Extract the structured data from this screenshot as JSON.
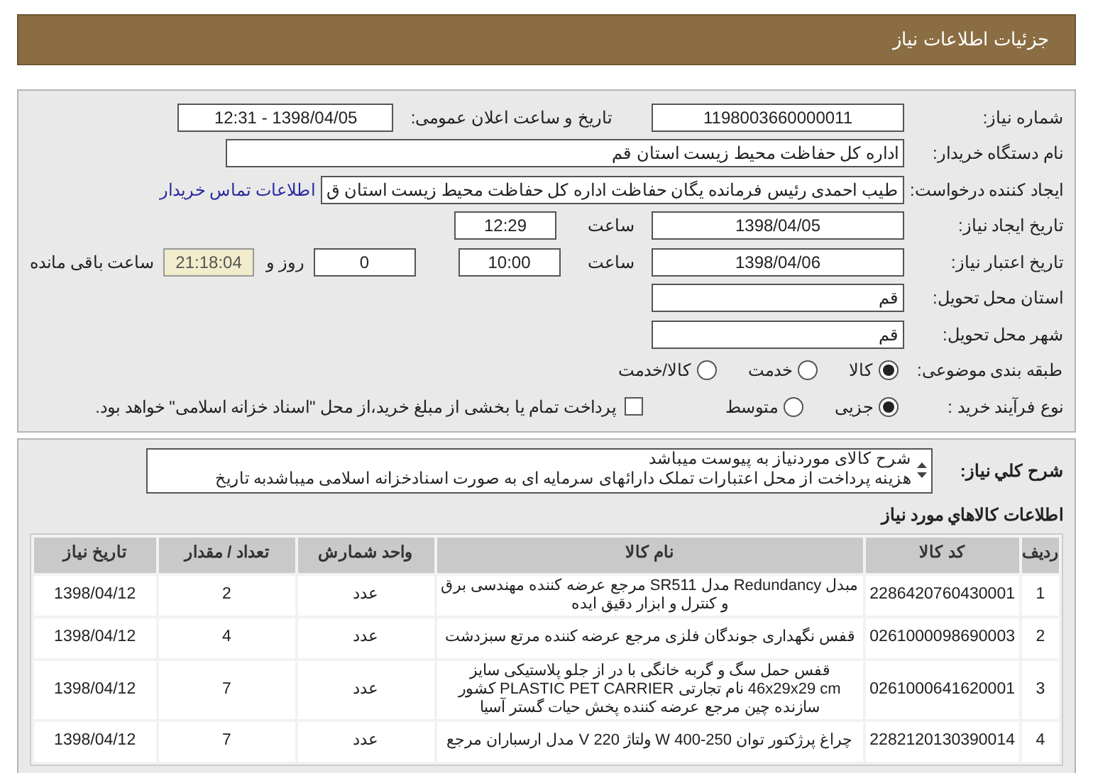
{
  "header": {
    "title": "جزئیات اطلاعات نیاز"
  },
  "fields": {
    "need_number": {
      "label": "شماره نیاز:",
      "value": "1198003660000011"
    },
    "announce": {
      "label": "تاریخ و ساعت اعلان عمومی:",
      "value": "1398/04/05 - 12:31"
    },
    "buyer": {
      "label": "نام دستگاه خریدار:",
      "value": "اداره کل حفاظت محیط زیست استان قم"
    },
    "creator": {
      "label": "ایجاد کننده درخواست:",
      "value": "طیب احمدی رئیس فرمانده یگان حفاظت اداره کل حفاظت محیط زیست استان ق",
      "link": "اطلاعات تماس خریدار"
    },
    "created": {
      "label": "تاریخ ایجاد نیاز:",
      "date": "1398/04/05",
      "time_label": "ساعت",
      "time": "12:29"
    },
    "valid": {
      "label": "تاریخ اعتبار نیاز:",
      "date": "1398/04/06",
      "time_label": "ساعت",
      "time": "10:00",
      "days": "0",
      "days_label": "روز و",
      "remaining": "21:18:04",
      "remaining_label": "ساعت باقی مانده"
    },
    "province": {
      "label": "استان محل تحویل:",
      "value": "قم"
    },
    "city": {
      "label": "شهر محل تحویل:",
      "value": "قم"
    }
  },
  "category": {
    "label": "طبقه بندی موضوعی:",
    "options": [
      {
        "label": "کالا",
        "selected": true
      },
      {
        "label": "خدمت",
        "selected": false
      },
      {
        "label": "کالا/خدمت",
        "selected": false
      }
    ]
  },
  "process": {
    "label": "نوع فرآیند خرید :",
    "options": [
      {
        "label": "جزیی",
        "selected": true
      },
      {
        "label": "متوسط",
        "selected": false
      }
    ],
    "treasury": {
      "label": "پرداخت تمام یا بخشی از مبلغ خرید،از محل \"اسناد خزانه اسلامی\" خواهد بود.",
      "checked": false
    }
  },
  "description": {
    "label": "شرح کلي نياز:",
    "lines": [
      "شرح کالای موردنیاز به پیوست میباشد",
      "هزینه پرداخت از محل اعتبارات تملک دارائهای سرمایه ای به صورت اسنادخزانه اسلامی میباشدبه تاریخ"
    ]
  },
  "goods": {
    "title": "اطلاعات کالاهاي مورد نياز",
    "columns": [
      "ردیف",
      "کد کالا",
      "نام کالا",
      "واحد شمارش",
      "تعداد / مقدار",
      "تاریخ نیاز"
    ],
    "rows": [
      [
        "1",
        "2286420760430001",
        "مبدل Redundancy مدل SR511 مرجع عرضه کننده مهندسی برق و کنترل و ابزار دقیق ایده",
        "عدد",
        "2",
        "1398/04/12"
      ],
      [
        "2",
        "0261000098690003",
        "قفس نگهداری جوندگان فلزی مرجع عرضه کننده مرتع سبزدشت",
        "عدد",
        "4",
        "1398/04/12"
      ],
      [
        "3",
        "0261000641620001",
        "قفس حمل سگ و گربه خانگی با در از جلو پلاستیکی سایز 46x29x29 cm نام تجارتی PLASTIC PET CARRIER کشور سازنده چین مرجع عرضه کننده پخش حیات گستر آسیا",
        "عدد",
        "7",
        "1398/04/12"
      ],
      [
        "4",
        "2282120130390014",
        "چراغ پرژکتور توان 250-400 W ولتاژ 220 V مدل ارسباران مرجع",
        "عدد",
        "7",
        "1398/04/12"
      ]
    ]
  }
}
